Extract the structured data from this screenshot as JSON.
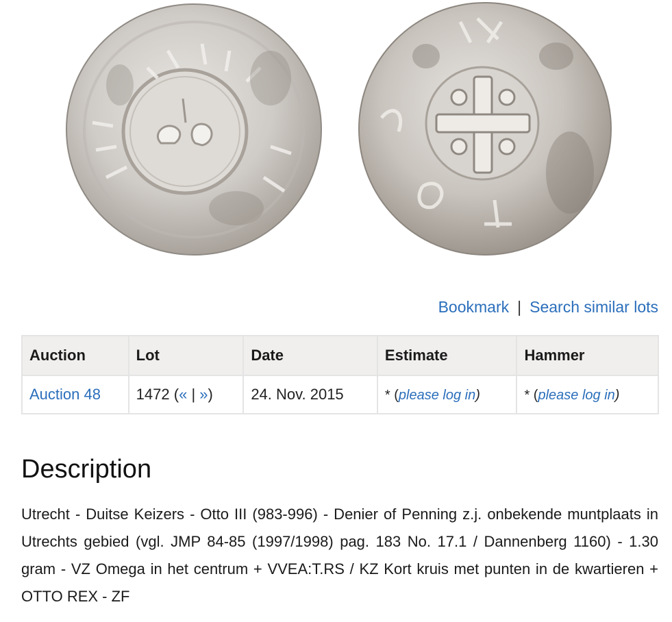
{
  "coins": {
    "obverse_icon": "coin-obverse-omega",
    "reverse_icon": "coin-reverse-cross",
    "color": "#cfcbc6"
  },
  "links": {
    "bookmark": "Bookmark",
    "separator": "|",
    "search_similar": "Search similar lots"
  },
  "table": {
    "headers": [
      "Auction",
      "Lot",
      "Date",
      "Estimate",
      "Hammer"
    ],
    "row": {
      "auction": "Auction 48",
      "lot_number": "1472",
      "lot_open": "(",
      "prev": "«",
      "lot_sep": "|",
      "next": "»",
      "lot_close": ")",
      "date": "24. Nov. 2015",
      "estimate_star": "* (",
      "estimate_link": "please log in",
      "estimate_close": ")",
      "hammer_star": "* (",
      "hammer_link": "please log in",
      "hammer_close": ")"
    }
  },
  "description": {
    "title": "Description",
    "text": "Utrecht - Duitse Keizers - Otto III (983-996) - Denier of Penning z.j. onbekende muntplaats in Utrechts gebied (vgl. JMP 84-85 (1997/1998) pag. 183 No. 17.1 / Dannenberg 1160) - 1.30 gram - VZ Omega in het centrum + VVEA:T.RS / KZ Kort kruis met punten in de kwartieren + OTTO REX - ZF"
  },
  "colors": {
    "link": "#2a6ebb",
    "header_bg": "#f0efed",
    "border": "#e4e4e4"
  }
}
